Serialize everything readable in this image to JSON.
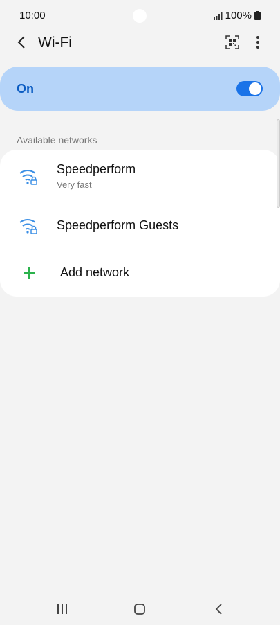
{
  "status": {
    "time": "10:00",
    "battery": "100%"
  },
  "header": {
    "title": "Wi-Fi"
  },
  "master": {
    "label": "On",
    "enabled": true
  },
  "section": {
    "available": "Available networks"
  },
  "networks": [
    {
      "name": "Speedperform",
      "subtitle": "Very fast",
      "icon": "wifi-lock-icon"
    },
    {
      "name": "Speedperform Guests",
      "icon": "wifi-lock-icon"
    }
  ],
  "add": {
    "label": "Add network"
  },
  "colors": {
    "accent": "#1a73e8",
    "toggle_bg": "#b5d4f9",
    "plus": "#2bb24c",
    "wifi_icon": "#3b8fe5"
  }
}
